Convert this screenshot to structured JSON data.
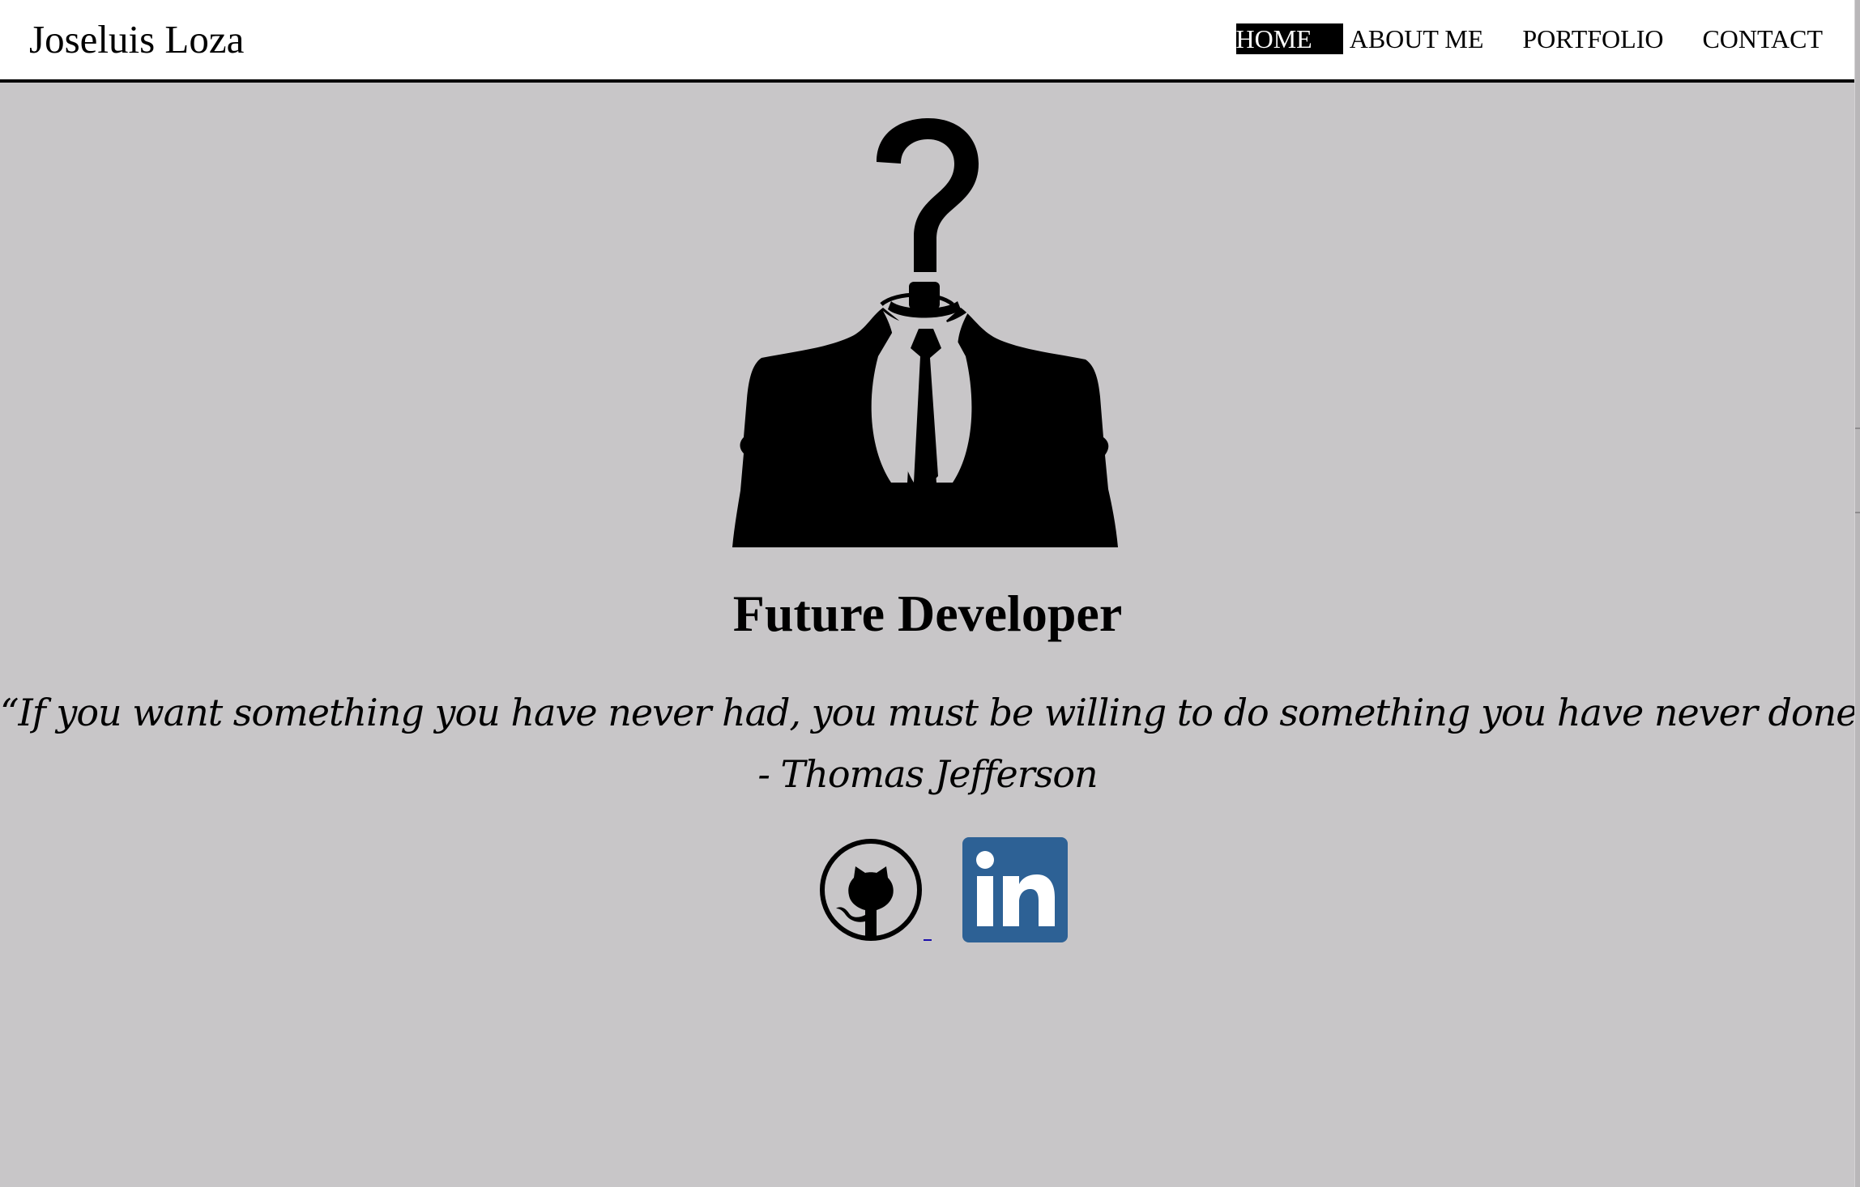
{
  "site": {
    "brand": "Joseluis Loza"
  },
  "nav": {
    "items": [
      {
        "label": "HOME",
        "active": true
      },
      {
        "label": "ABOUT ME",
        "active": false
      },
      {
        "label": "PORTFOLIO",
        "active": false
      },
      {
        "label": "CONTACT",
        "active": false
      }
    ]
  },
  "hero": {
    "image_icon": "mystery-businessman-silhouette-icon",
    "title": "Future Developer",
    "quote_line_1": "“If you want something you have never had, you must be willing to do something you have never done.",
    "quote_line_2": "- Thomas Jefferson"
  },
  "socials": {
    "github_icon": "github-octocat-icon",
    "linkedin_icon": "linkedin-icon",
    "linkedin_color": "#2d6195"
  },
  "colors": {
    "page_background": "#c8c6c8",
    "header_background": "#ffffff",
    "active_nav_background": "#000000",
    "active_nav_text": "#ffffff"
  }
}
